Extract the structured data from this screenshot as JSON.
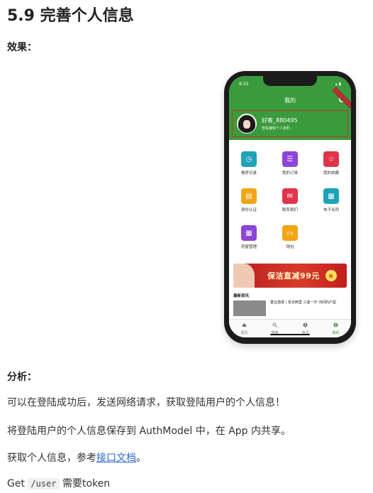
{
  "doc": {
    "heading": "5.9 完善个人信息",
    "effect_label": "效果：",
    "analysis_label": "分析：",
    "para1": "可以在登陆成功后，发送网络请求，获取登陆用户的个人信息！",
    "para2": "将登陆用户的个人信息保存到 AuthModel 中，在 App 内共享。",
    "para3_prefix": "获取个人信息，参考",
    "para3_link": "接口文档",
    "para3_suffix": "。",
    "para4_prefix": "Get ",
    "para4_code": "/user",
    "para4_suffix": " 需要token"
  },
  "phone": {
    "time": "8:33",
    "title": "我的",
    "username": "好客_880495",
    "profile_hint": "查看编辑个人资料",
    "grid": [
      {
        "label": "看房记录",
        "color": "#1fa2b8",
        "icon": "clock-icon"
      },
      {
        "label": "我的订单",
        "color": "#8e44d8",
        "icon": "list-icon"
      },
      {
        "label": "我的收藏",
        "color": "#e0344b",
        "icon": "star-icon"
      },
      {
        "label": "身份认证",
        "color": "#f2a516",
        "icon": "id-icon"
      },
      {
        "label": "联系我们",
        "color": "#e0344b",
        "icon": "chat-icon"
      },
      {
        "label": "电子合同",
        "color": "#1fa2b8",
        "icon": "contract-icon"
      },
      {
        "label": "房屋管理",
        "color": "#8e44d8",
        "icon": "grid-icon"
      },
      {
        "label": "钱包",
        "color": "#f2a516",
        "icon": "wallet-icon"
      }
    ],
    "banner_text": "保洁直减99元",
    "banner_button": "抢",
    "news_title": "最新资讯",
    "news_item": "置业选择 | 安贞西里 三室一厅 河间的户型",
    "tabs": [
      {
        "label": "首页",
        "icon": "home-icon"
      },
      {
        "label": "搜索",
        "icon": "search-icon"
      },
      {
        "label": "资讯",
        "icon": "info-icon"
      },
      {
        "label": "我的",
        "icon": "user-icon"
      }
    ],
    "active_tab": "我的"
  }
}
